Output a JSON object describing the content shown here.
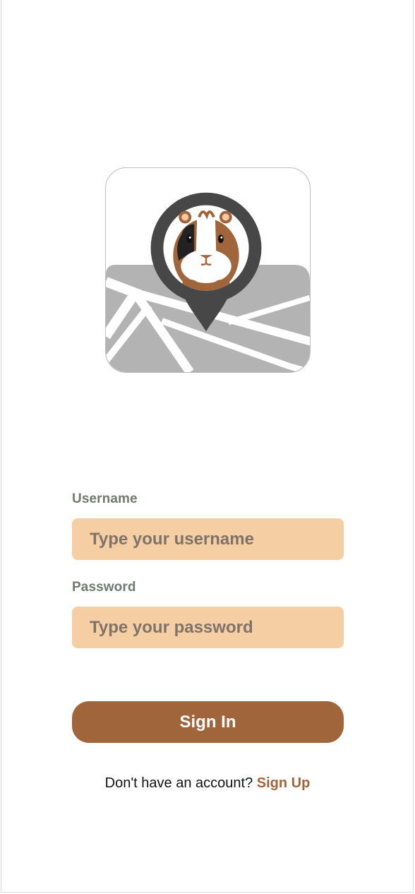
{
  "logo": {
    "icon": "guinea-pig-map-pin-logo",
    "colors": {
      "map_background": "#b3b3b3",
      "roads": "#ffffff",
      "pin": "#474747",
      "fur_brown": "#a0653a",
      "fur_black": "#222222"
    }
  },
  "form": {
    "username_label": "Username",
    "username_placeholder": "Type your username",
    "username_value": "",
    "password_label": "Password",
    "password_placeholder": "Type your password",
    "password_value": ""
  },
  "actions": {
    "signin_label": "Sign In"
  },
  "footer": {
    "prompt": "Don't have an account?",
    "signup_label": "Sign Up"
  },
  "colors": {
    "input_background": "#f6cea3",
    "primary": "#a0653a",
    "label": "#6f7a70"
  }
}
